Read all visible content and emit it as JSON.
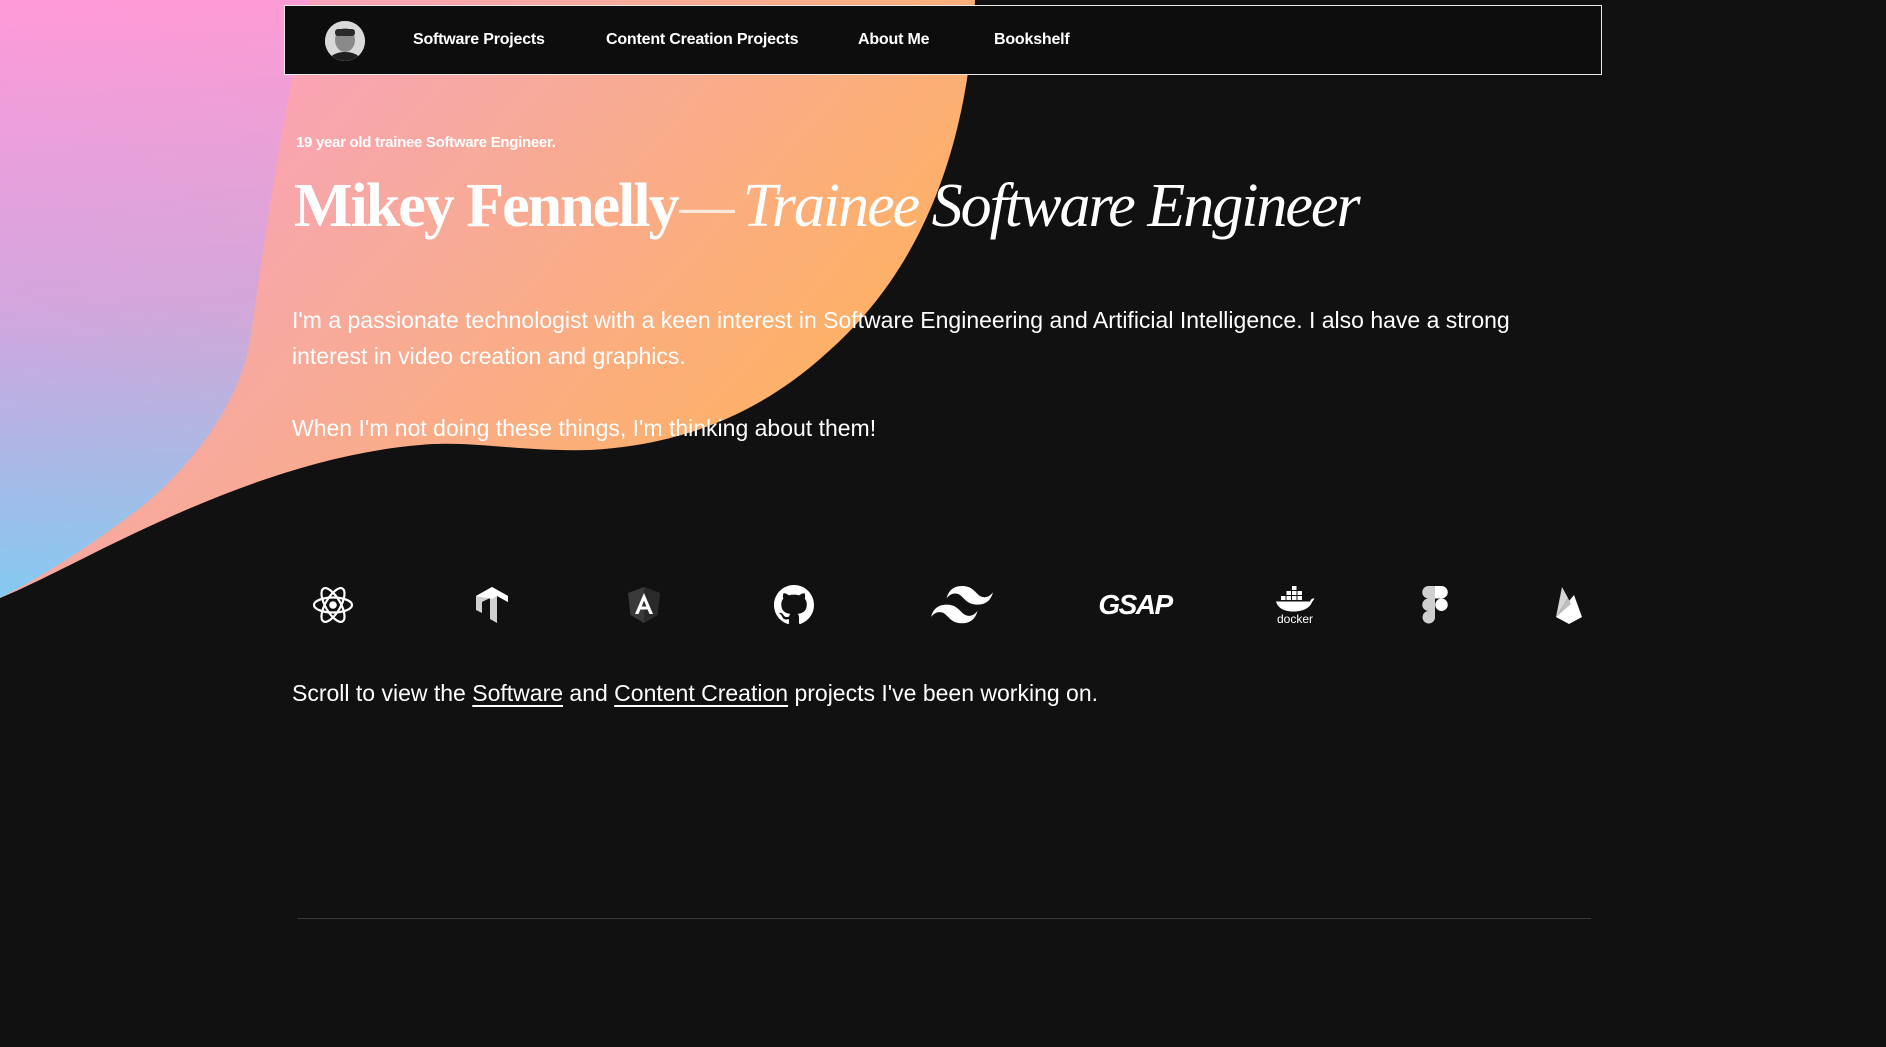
{
  "nav": {
    "avatar_alt": "Profile photo",
    "links": [
      {
        "label": "Software Projects"
      },
      {
        "label": "Content Creation Projects"
      },
      {
        "label": "About Me"
      },
      {
        "label": "Bookshelf"
      }
    ]
  },
  "hero": {
    "tagline": "19 year old trainee Software Engineer.",
    "name": "Mikey Fennelly",
    "dash": "—",
    "role": "Trainee Software Engineer",
    "intro": "I'm a passionate technologist with a keen interest in Software Engineering and Artificial Intelligence. I also have a strong interest in video creation and graphics.",
    "intro2": "When I'm not doing these things, I'm thinking about them!"
  },
  "tech_icons": [
    {
      "icon": "react-icon"
    },
    {
      "icon": "tensorflow-icon"
    },
    {
      "icon": "angular-icon"
    },
    {
      "icon": "github-icon"
    },
    {
      "icon": "tailwind-icon"
    },
    {
      "icon": "gsap-icon",
      "label": "GSAP"
    },
    {
      "icon": "docker-icon",
      "label": "docker"
    },
    {
      "icon": "figma-icon"
    },
    {
      "icon": "firebase-icon"
    }
  ],
  "scroll": {
    "prefix": "Scroll to view the ",
    "link_software": "Software",
    "middle": " and ",
    "link_content": "Content Creation",
    "suffix": " projects I've been working on."
  },
  "colors": {
    "background": "#111111",
    "gradient_pink": "#ff9ad5",
    "gradient_orange": "#ffb05c",
    "gradient_blue": "#6fd0ff",
    "text": "#ffffff"
  }
}
